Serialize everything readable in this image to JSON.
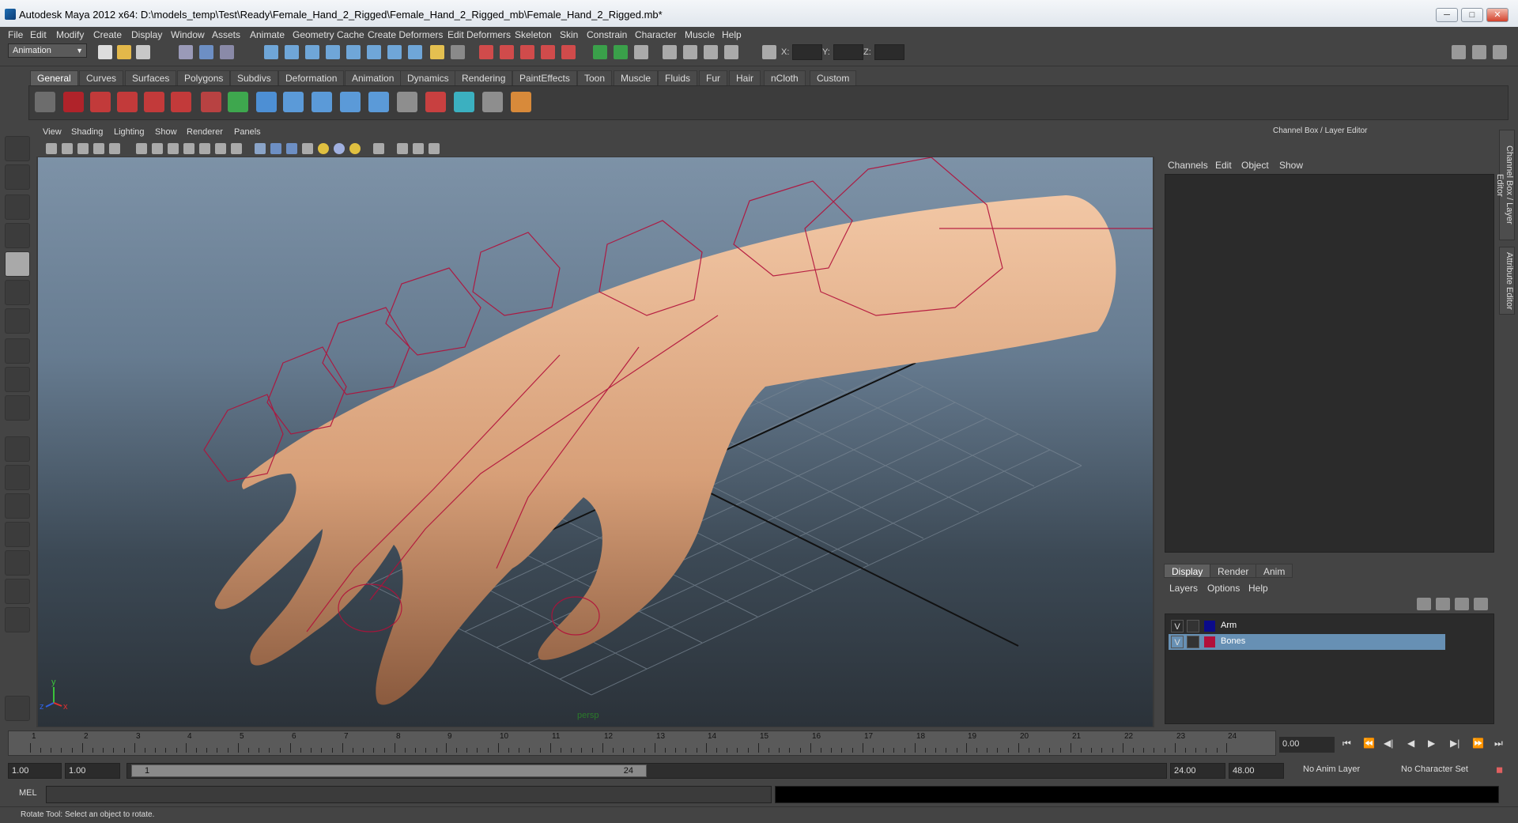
{
  "window": {
    "title": "Autodesk Maya 2012 x64: D:\\models_temp\\Test\\Ready\\Female_Hand_2_Rigged\\Female_Hand_2_Rigged_mb\\Female_Hand_2_Rigged.mb*",
    "min": "─",
    "max": "□",
    "close": "✕"
  },
  "menu": [
    "File",
    "Edit",
    "Modify",
    "Create",
    "Display",
    "Window",
    "Assets",
    "Animate",
    "Geometry Cache",
    "Create Deformers",
    "Edit Deformers",
    "Skeleton",
    "Skin",
    "Constrain",
    "Character",
    "Muscle",
    "Help"
  ],
  "status_line": {
    "mode": "Animation",
    "x_label": "X:",
    "y_label": "Y:",
    "z_label": "Z:"
  },
  "shelf": {
    "tabs": [
      "General",
      "Curves",
      "Surfaces",
      "Polygons",
      "Subdivs",
      "Deformation",
      "Animation",
      "Dynamics",
      "Rendering",
      "PaintEffects",
      "Toon",
      "Muscle",
      "Fluids",
      "Fur",
      "Hair",
      "nCloth",
      "Custom"
    ],
    "active_tab": "General"
  },
  "viewport": {
    "menu": [
      "View",
      "Shading",
      "Lighting",
      "Show",
      "Renderer",
      "Panels"
    ],
    "camera": "persp",
    "axis": {
      "y": "y",
      "x": "x",
      "z": "z"
    }
  },
  "channel_box": {
    "title": "Channel Box / Layer Editor",
    "menu": [
      "Channels",
      "Edit",
      "Object",
      "Show"
    ]
  },
  "layer_editor": {
    "tabs": [
      "Display",
      "Render",
      "Anim"
    ],
    "active_tab": "Display",
    "menu": [
      "Layers",
      "Options",
      "Help"
    ],
    "layers": [
      {
        "visible": "V",
        "name": "Arm",
        "color": "#0b0b8a",
        "selected": false
      },
      {
        "visible": "V",
        "name": "Bones",
        "color": "#b2103a",
        "selected": true
      }
    ]
  },
  "side_tabs": [
    "Channel Box / Layer Editor",
    "Attribute Editor"
  ],
  "time_slider": {
    "ticks": [
      "1",
      "2",
      "3",
      "4",
      "5",
      "6",
      "7",
      "8",
      "9",
      "10",
      "11",
      "12",
      "13",
      "14",
      "15",
      "16",
      "17",
      "18",
      "19",
      "20",
      "21",
      "22",
      "23",
      "24"
    ],
    "current_frame": "0.00",
    "playback_buttons": [
      "⏮",
      "⏪",
      "◀|",
      "◀",
      "▶",
      "▶|",
      "⏩",
      "⏭"
    ]
  },
  "range_slider": {
    "start": "1.00",
    "start_inner": "1.00",
    "range_start": "1",
    "range_end": "24",
    "end_inner": "24.00",
    "end": "48.00",
    "anim_layer": "No Anim Layer",
    "character_set": "No Character Set"
  },
  "command_line": {
    "label": "MEL"
  },
  "help_line": "Rotate Tool: Select an object to rotate.",
  "colors": {
    "panel": "#444444",
    "viewport_top": "#7d92a7",
    "viewport_bottom": "#2b3239",
    "skin": "#e0b090",
    "bones": "#b2103a",
    "selection": "#6790b4"
  }
}
